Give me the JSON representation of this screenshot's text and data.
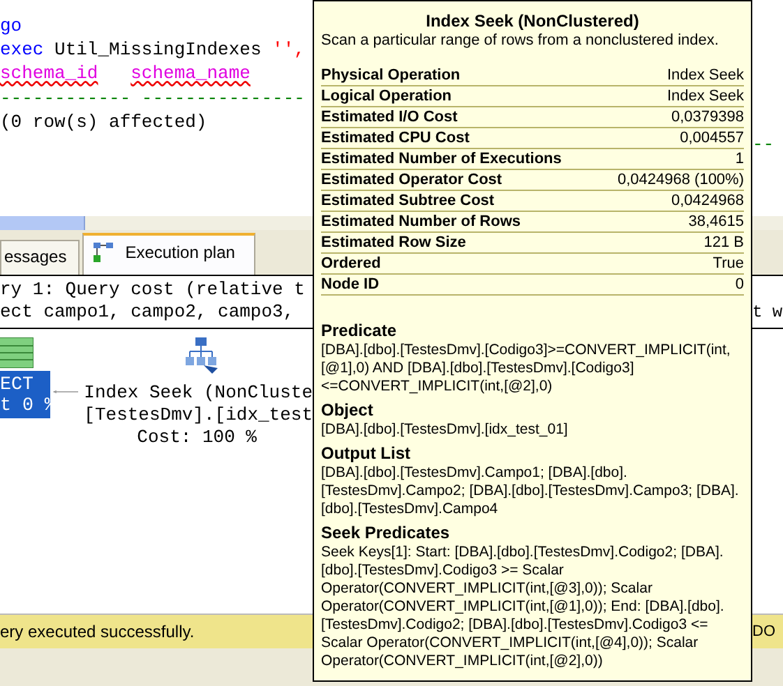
{
  "editor": {
    "lines": [
      {
        "kind": "code",
        "segments": [
          {
            "kind": "keyword",
            "text": "go"
          }
        ]
      },
      {
        "kind": "code",
        "segments": [
          {
            "kind": "keyword",
            "text": "exec"
          },
          {
            "kind": "plain",
            "text": " Util_MissingIndexes "
          },
          {
            "kind": "string",
            "text": "'',"
          }
        ]
      },
      {
        "kind": "code",
        "segments": [
          {
            "kind": "heading",
            "text": "schema_id"
          },
          {
            "kind": "heading",
            "text": "schema_name"
          }
        ]
      },
      {
        "kind": "code",
        "segments": [
          {
            "kind": "rule",
            "text": "------------ ---------------"
          }
        ]
      },
      {
        "kind": "code",
        "segments": [
          {
            "kind": "plain",
            "text": "(0 row(s) affected)"
          }
        ]
      }
    ]
  },
  "tabs": [
    {
      "label": "essages",
      "selected": false,
      "kind": "messages"
    },
    {
      "label": "Execution plan",
      "selected": true,
      "kind": "plan"
    }
  ],
  "plan": {
    "header_lines": [
      "ry 1: Query cost (relative t",
      "ect campo1, campo2, campo3,"
    ],
    "select_node": {
      "label": "ECT",
      "cost": "t 0 %"
    },
    "seek_node": {
      "lines": [
        "Index Seek (NonCluste",
        "[TestesDmv].[idx_test"
      ],
      "cost": "Cost: 100 %"
    }
  },
  "status_bar": {
    "message": "ery executed successfully."
  },
  "right_edge": {
    "rule": "--",
    "plan_text": "t w",
    "status_text": "DO"
  },
  "tooltip": {
    "title": "Index Seek (NonClustered)",
    "description": "Scan a particular range of rows from a nonclustered index.",
    "properties": [
      {
        "label": "Physical Operation",
        "value": "Index Seek"
      },
      {
        "label": "Logical Operation",
        "value": "Index Seek"
      },
      {
        "label": "Estimated I/O Cost",
        "value": "0,0379398"
      },
      {
        "label": "Estimated CPU Cost",
        "value": "0,004557"
      },
      {
        "label": "Estimated Number of Executions",
        "value": "1"
      },
      {
        "label": "Estimated Operator Cost",
        "value": "0,0424968 (100%)"
      },
      {
        "label": "Estimated Subtree Cost",
        "value": "0,0424968"
      },
      {
        "label": "Estimated Number of Rows",
        "value": "38,4615"
      },
      {
        "label": "Estimated Row Size",
        "value": "121 B"
      },
      {
        "label": "Ordered",
        "value": "True"
      },
      {
        "label": "Node ID",
        "value": "0"
      }
    ],
    "sections": [
      {
        "heading": "Predicate",
        "text": "[DBA].[dbo].[TestesDmv].[Codigo3]>=CONVERT_IMPLICIT(int,[@1],0) AND [DBA].[dbo].[TestesDmv].[Codigo3]<=CONVERT_IMPLICIT(int,[@2],0)"
      },
      {
        "heading": "Object",
        "text": "[DBA].[dbo].[TestesDmv].[idx_test_01]"
      },
      {
        "heading": "Output List",
        "text": "[DBA].[dbo].[TestesDmv].Campo1; [DBA].[dbo].[TestesDmv].Campo2; [DBA].[dbo].[TestesDmv].Campo3; [DBA].[dbo].[TestesDmv].Campo4"
      },
      {
        "heading": "Seek Predicates",
        "text": "Seek Keys[1]: Start: [DBA].[dbo].[TestesDmv].Codigo2; [DBA].[dbo].[TestesDmv].Codigo3 >= Scalar Operator(CONVERT_IMPLICIT(int,[@3],0)); Scalar Operator(CONVERT_IMPLICIT(int,[@1],0)); End: [DBA].[dbo].[TestesDmv].Codigo2; [DBA].[dbo].[TestesDmv].Codigo3 <= Scalar Operator(CONVERT_IMPLICIT(int,[@4],0)); Scalar Operator(CONVERT_IMPLICIT(int,[@2],0))"
      }
    ]
  }
}
